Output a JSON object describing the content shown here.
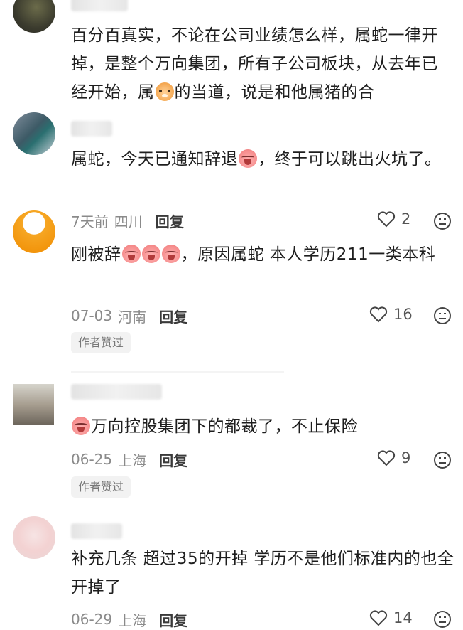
{
  "comments": [
    {
      "text_parts": [
        "百分百真实，不论在公司业绩怎么样，属蛇一律开掉，是整个万向集团，所有子公司板块，从去年已经开始，属",
        "的当道，说是和他属猪的合"
      ],
      "emoji": "tiger-emoji"
    },
    {
      "text_parts": [
        "属蛇，今天已通知辞退",
        "，终于可以跳出火坑了。"
      ],
      "date": "7天前",
      "location": "四川",
      "reply": "回复",
      "likes": "2"
    },
    {
      "text_parts": [
        "刚被辞",
        "，原因属蛇 本人学历211一类本科"
      ],
      "date": "07-03",
      "location": "河南",
      "reply": "回复",
      "likes": "16",
      "badge": "作者赞过"
    },
    {
      "text_parts": [
        "",
        "万向控股集团下的都裁了，不止保险"
      ],
      "date": "06-25",
      "location": "上海",
      "reply": "回复",
      "likes": "9",
      "badge": "作者赞过"
    },
    {
      "text_parts": [
        "补充几条 超过35的开掉 学历不是他们标准内的也全开掉了"
      ],
      "date": "06-29",
      "location": "上海",
      "reply": "回复",
      "likes": "14"
    }
  ],
  "colors": {
    "text": "#1e1e1e",
    "meta": "#8a8a8a",
    "badge_bg": "#f2f2f2"
  }
}
